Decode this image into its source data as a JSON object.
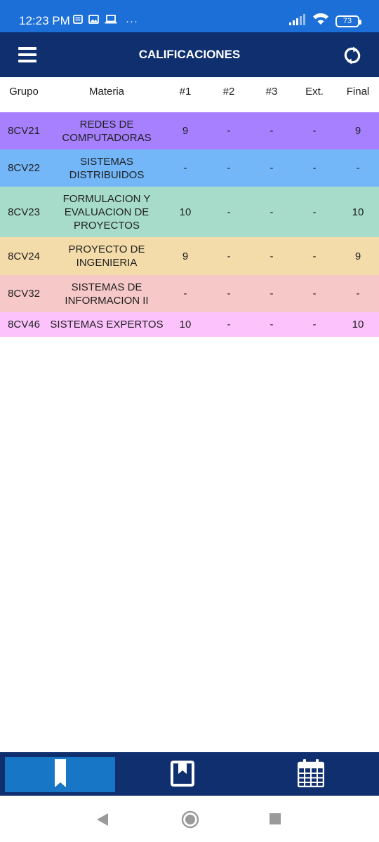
{
  "status_bar": {
    "time": "12:23 PM",
    "left_icons": [
      "message-icon",
      "image-icon",
      "laptop-icon",
      "more-icon"
    ],
    "more": "···",
    "battery": "73"
  },
  "app_bar": {
    "title": "CALIFICACIONES",
    "menu_icon": "menu-icon",
    "refresh_icon": "refresh-icon"
  },
  "table": {
    "headers": [
      "Grupo",
      "Materia",
      "#1",
      "#2",
      "#3",
      "Ext.",
      "Final"
    ],
    "rows": [
      {
        "grupo": "8CV21",
        "materia": "REDES DE COMPUTADORAS",
        "p1": "9",
        "p2": "-",
        "p3": "-",
        "ext": "-",
        "final": "9",
        "color": "#a680ff"
      },
      {
        "grupo": "8CV22",
        "materia": "SISTEMAS DISTRIBUIDOS",
        "p1": "-",
        "p2": "-",
        "p3": "-",
        "ext": "-",
        "final": "-",
        "color": "#73b7f9"
      },
      {
        "grupo": "8CV23",
        "materia": "FORMULACION Y EVALUACION DE PROYECTOS",
        "p1": "10",
        "p2": "-",
        "p3": "-",
        "ext": "-",
        "final": "10",
        "color": "#a7dccb"
      },
      {
        "grupo": "8CV24",
        "materia": "PROYECTO DE INGENIERIA",
        "p1": "9",
        "p2": "-",
        "p3": "-",
        "ext": "-",
        "final": "9",
        "color": "#f4dcaa"
      },
      {
        "grupo": "8CV32",
        "materia": "SISTEMAS DE INFORMACION II",
        "p1": "-",
        "p2": "-",
        "p3": "-",
        "ext": "-",
        "final": "-",
        "color": "#f6c8c8"
      },
      {
        "grupo": "8CV46",
        "materia": "SISTEMAS EXPERTOS",
        "p1": "10",
        "p2": "-",
        "p3": "-",
        "ext": "-",
        "final": "10",
        "color": "#fbc2fb"
      }
    ]
  },
  "bottom_nav": {
    "items": [
      {
        "icon": "bookmark-icon",
        "active": true
      },
      {
        "icon": "book-icon",
        "active": false
      },
      {
        "icon": "calendar-icon",
        "active": false
      }
    ]
  },
  "colors": {
    "status_bar": "#1b6fd6",
    "app_bar": "#0f2f6e",
    "active_nav": "#1776c6"
  }
}
